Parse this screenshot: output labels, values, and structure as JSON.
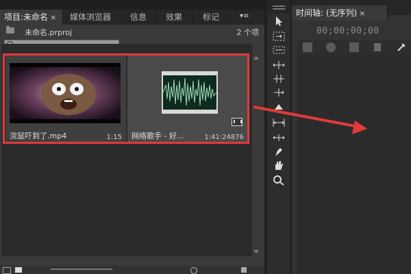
{
  "project_panel": {
    "tabs": [
      {
        "label": "项目:未命名",
        "active": true,
        "closable": true
      },
      {
        "label": "媒体浏览器",
        "active": false
      },
      {
        "label": "信息",
        "active": false
      },
      {
        "label": "效果",
        "active": false
      },
      {
        "label": "标记",
        "active": false
      }
    ],
    "project_file": "未命名.prproj",
    "item_count": "2 个项",
    "search_value": "",
    "items": [
      {
        "name": "浣鼠吓到了.mp4",
        "duration": "1:15",
        "type": "video"
      },
      {
        "name": "网络歌手 - 好...",
        "duration": "1:41:24876",
        "type": "audio"
      }
    ]
  },
  "timeline_panel": {
    "tab_label": "时间轴: (无序列)",
    "timecode": "00;00;00;00"
  },
  "tools": [
    "selection-tool",
    "track-select-tool",
    "ripple-edit-tool",
    "rolling-edit-tool",
    "rate-stretch-tool",
    "razor-tool",
    "slip-tool",
    "slide-tool",
    "pen-tool",
    "hand-tool",
    "zoom-tool"
  ],
  "annotation": {
    "box_color": "#e23a3a",
    "arrow_color": "#e23a3a"
  }
}
